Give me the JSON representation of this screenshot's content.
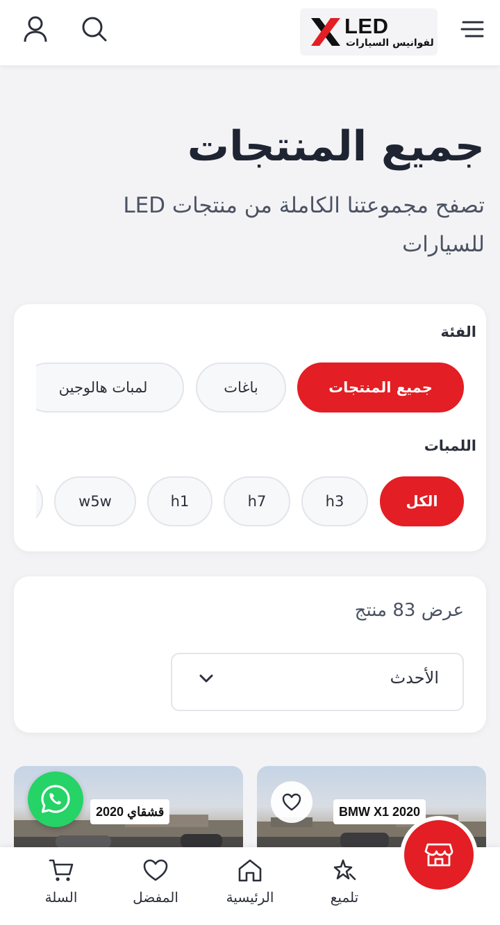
{
  "header": {
    "logo_brand": "LED",
    "logo_subtitle": "لفوانيس السيارات"
  },
  "page": {
    "title": "جميع المنتجات",
    "subtitle": "تصفح مجموعتنا الكاملة من منتجات LED للسيارات"
  },
  "filters": {
    "category_label": "الفئة",
    "categories": [
      {
        "label": "جميع المنتجات",
        "active": true
      },
      {
        "label": "باغات",
        "active": false
      },
      {
        "label": "لمبات هالوجين",
        "active": false
      }
    ],
    "bulbs_label": "اللمبات",
    "bulbs": [
      {
        "label": "الكل",
        "active": true
      },
      {
        "label": "h3",
        "active": false
      },
      {
        "label": "h7",
        "active": false
      },
      {
        "label": "h1",
        "active": false
      },
      {
        "label": "w5w",
        "active": false
      }
    ]
  },
  "results": {
    "count_text": "عرض 83 منتج",
    "sort_selected": "الأحدث"
  },
  "products": [
    {
      "tag": "BMW X1 2020"
    },
    {
      "tag": "قشقاي 2020"
    }
  ],
  "bottom_nav": {
    "polish": "تلميع",
    "home": "الرئيسية",
    "favorites": "المفضل",
    "cart": "السلة"
  },
  "icons": {
    "header": [
      "user-icon",
      "search-icon",
      "menu-icon"
    ],
    "fab": "store-icon",
    "chat": "whatsapp-icon"
  },
  "colors": {
    "accent": "#e31e24",
    "whatsapp": "#25d366",
    "background": "#f3f3f5"
  }
}
